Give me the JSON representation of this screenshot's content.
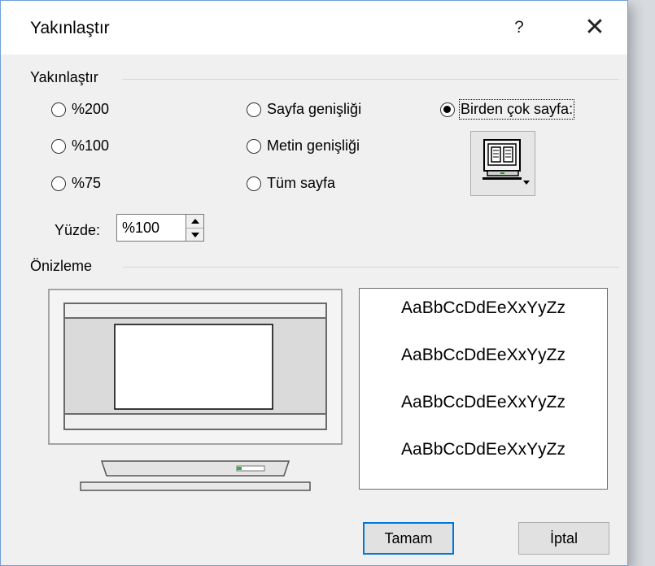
{
  "dialog": {
    "title": "Yakınlaştır",
    "help": "?",
    "close": "✕"
  },
  "zoom_group": {
    "label": "Yakınlaştır",
    "options": {
      "p200": "%200",
      "p100": "%100",
      "p75": "%75",
      "page_width": "Sayfa genişliği",
      "text_width": "Metin genişliği",
      "whole_page": "Tüm sayfa",
      "many_pages": "Birden çok sayfa:"
    },
    "selected": "many_pages",
    "percent_label": "Yüzde:",
    "percent_value": "%100"
  },
  "preview_group": {
    "label": "Önizleme",
    "samples": [
      "AaBbCcDdEeXxYyZz",
      "AaBbCcDdEeXxYyZz",
      "AaBbCcDdEeXxYyZz",
      "AaBbCcDdEeXxYyZz"
    ]
  },
  "buttons": {
    "ok": "Tamam",
    "cancel": "İptal"
  },
  "icons": {
    "pages": "monitor-pages-icon",
    "preview": "monitor-preview-icon"
  },
  "colors": {
    "accent": "#0078d7",
    "dialog_bg": "#f0f0f0"
  }
}
